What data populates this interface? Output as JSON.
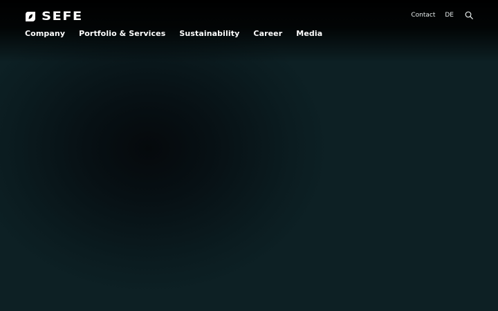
{
  "brand": {
    "name": "SEFE",
    "logo_icon": "sefe-leaf-icon"
  },
  "utility_nav": {
    "contact": "Contact",
    "language": "DE",
    "search_icon": "search-icon"
  },
  "main_nav": {
    "items": [
      {
        "label": "Company"
      },
      {
        "label": "Portfolio & Services"
      },
      {
        "label": "Sustainability"
      },
      {
        "label": "Career"
      },
      {
        "label": "Media"
      }
    ]
  },
  "colors": {
    "background": "#0d2024",
    "text": "#ffffff"
  }
}
